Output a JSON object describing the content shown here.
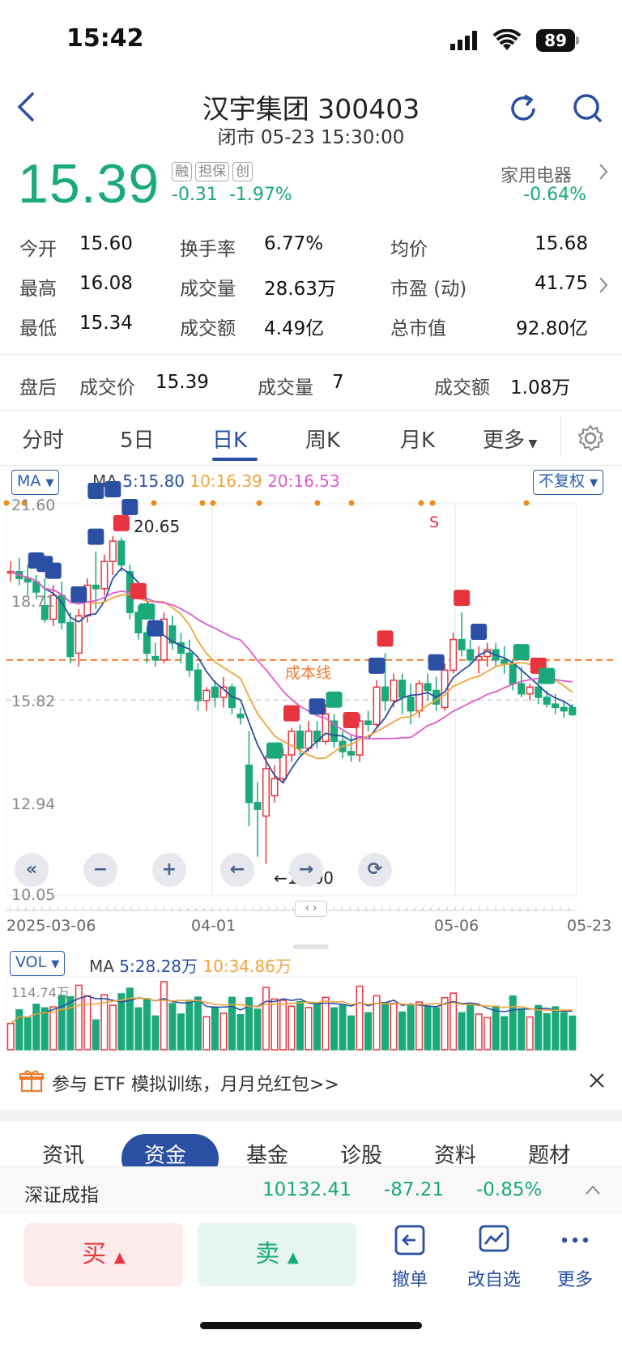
{
  "status": {
    "time": "15:42",
    "battery": "89"
  },
  "header": {
    "title": "汉宇集团 300403",
    "subtitle": "闭市 05-23 15:30:00",
    "price": "15.39",
    "tags": [
      "融",
      "担保",
      "创"
    ],
    "change_abs": "-0.31",
    "change_pct": "-1.97%",
    "industry": "家用电器",
    "industry_change": "-0.64%"
  },
  "stats": {
    "open_label": "今开",
    "open": "15.60",
    "turnover_label": "换手率",
    "turnover": "6.77%",
    "avg_label": "均价",
    "avg": "15.68",
    "high_label": "最高",
    "high": "16.08",
    "volume_label": "成交量",
    "volume": "28.63万",
    "pe_label": "市盈 (动)",
    "pe": "41.75",
    "low_label": "最低",
    "low": "15.34",
    "amount_label": "成交额",
    "amount": "4.49亿",
    "mcap_label": "总市值",
    "mcap": "92.80亿"
  },
  "after_hours": {
    "label": "盘后",
    "price_label": "成交价",
    "price": "15.39",
    "vol_label": "成交量",
    "vol": "7",
    "amt_label": "成交额",
    "amt": "1.08万"
  },
  "tabs": [
    "分时",
    "5日",
    "日K",
    "周K",
    "月K",
    "更多"
  ],
  "active_tab": "日K",
  "chart": {
    "ma_selector": "MA",
    "ma_title": "MA",
    "ma5": "5:15.80",
    "ma10": "10:16.39",
    "ma20": "20:16.53",
    "adjust": "不复权",
    "ylabels": [
      "21.60",
      "18.71",
      "15.82",
      "12.94",
      "10.05"
    ],
    "max_label": "20.65",
    "min_label": "←11.00",
    "cost_line": "成本线",
    "s_marker": "S",
    "dates": [
      "2025-03-06",
      "04-01",
      "05-06",
      "05-23"
    ],
    "vol_selector": "VOL",
    "vol_ma_title": "MA",
    "vol_ma5": "5:28.28万",
    "vol_ma10": "10:34.86万",
    "vol_max": "114.74万",
    "colors": {
      "up": "#e8343f",
      "down": "#1aa97a",
      "ma5": "#2a4fa3",
      "ma10": "#f2a33a",
      "ma20": "#e05ad0"
    }
  },
  "chart_data": {
    "type": "candlestick",
    "x_range": [
      "2025-03-06",
      "2025-05-23"
    ],
    "ylim": [
      10.05,
      21.6
    ],
    "series": [
      {
        "name": "MA",
        "values": []
      }
    ],
    "candles": [
      [
        19.6,
        19.9,
        19.3,
        19.6
      ],
      [
        19.6,
        20.0,
        19.2,
        19.4
      ],
      [
        19.4,
        19.8,
        18.9,
        19.3
      ],
      [
        19.3,
        19.5,
        18.8,
        19.0
      ],
      [
        18.6,
        19.4,
        18.1,
        18.2
      ],
      [
        18.2,
        19.2,
        18.0,
        18.9
      ],
      [
        18.9,
        19.3,
        17.9,
        18.1
      ],
      [
        18.1,
        18.4,
        16.9,
        17.1
      ],
      [
        17.2,
        18.5,
        16.8,
        18.3
      ],
      [
        18.3,
        19.4,
        18.1,
        19.2
      ],
      [
        19.2,
        20.2,
        18.5,
        19.1
      ],
      [
        19.1,
        20.1,
        18.9,
        19.9
      ],
      [
        19.9,
        20.65,
        19.5,
        20.5
      ],
      [
        20.5,
        20.6,
        19.6,
        19.8
      ],
      [
        19.6,
        19.8,
        18.2,
        18.4
      ],
      [
        18.4,
        18.6,
        17.6,
        17.8
      ],
      [
        17.8,
        18.0,
        16.9,
        17.2
      ],
      [
        17.1,
        17.5,
        16.8,
        17.0
      ],
      [
        17.0,
        18.4,
        16.9,
        18.2
      ],
      [
        18.0,
        18.3,
        17.3,
        17.5
      ],
      [
        17.5,
        17.8,
        16.9,
        17.2
      ],
      [
        17.2,
        17.6,
        16.5,
        16.7
      ],
      [
        16.7,
        16.9,
        15.5,
        15.8
      ],
      [
        15.8,
        16.2,
        15.5,
        16.1
      ],
      [
        16.2,
        16.4,
        15.6,
        15.9
      ],
      [
        15.9,
        16.5,
        15.6,
        16.2
      ],
      [
        16.2,
        16.3,
        15.4,
        15.6
      ],
      [
        15.4,
        15.6,
        15.1,
        15.3
      ],
      [
        13.9,
        14.9,
        12.1,
        12.8
      ],
      [
        12.8,
        13.4,
        11.2,
        12.6
      ],
      [
        12.4,
        14.2,
        11.0,
        13.8
      ],
      [
        13.0,
        13.9,
        12.8,
        13.5
      ],
      [
        13.5,
        14.4,
        13.4,
        14.2
      ],
      [
        14.2,
        15.0,
        14.0,
        14.9
      ],
      [
        14.9,
        15.1,
        14.2,
        14.4
      ],
      [
        14.4,
        15.2,
        14.3,
        14.9
      ],
      [
        14.9,
        15.2,
        14.4,
        14.6
      ],
      [
        14.6,
        15.7,
        14.5,
        15.4
      ],
      [
        15.2,
        15.4,
        14.4,
        14.6
      ],
      [
        14.6,
        14.9,
        14.1,
        14.3
      ],
      [
        14.3,
        14.8,
        14.0,
        14.2
      ],
      [
        14.2,
        15.4,
        14.0,
        15.2
      ],
      [
        15.2,
        15.5,
        14.9,
        15.1
      ],
      [
        15.1,
        16.4,
        15.0,
        16.2
      ],
      [
        16.2,
        17.2,
        15.5,
        15.8
      ],
      [
        15.8,
        16.6,
        15.6,
        16.4
      ],
      [
        16.4,
        16.6,
        15.4,
        15.9
      ],
      [
        15.9,
        16.3,
        15.1,
        15.5
      ],
      [
        15.5,
        16.4,
        15.3,
        16.3
      ],
      [
        16.3,
        16.6,
        15.8,
        16.1
      ],
      [
        16.1,
        16.5,
        15.5,
        15.7
      ],
      [
        15.6,
        16.9,
        15.5,
        16.7
      ],
      [
        16.7,
        17.8,
        16.6,
        17.6
      ],
      [
        17.6,
        18.4,
        17.1,
        17.3
      ],
      [
        17.3,
        17.6,
        16.9,
        17.0
      ],
      [
        17.0,
        17.4,
        16.6,
        17.1
      ],
      [
        17.1,
        17.5,
        16.8,
        17.3
      ],
      [
        17.3,
        17.5,
        16.8,
        17.0
      ],
      [
        17.0,
        17.4,
        16.6,
        16.9
      ],
      [
        16.9,
        17.0,
        16.1,
        16.3
      ],
      [
        16.3,
        16.8,
        15.9,
        16.0
      ],
      [
        16.0,
        16.3,
        15.8,
        16.2
      ],
      [
        16.2,
        16.4,
        15.7,
        15.9
      ],
      [
        15.9,
        16.1,
        15.6,
        15.7
      ],
      [
        15.7,
        16.0,
        15.4,
        15.6
      ],
      [
        15.6,
        15.8,
        15.3,
        15.5
      ],
      [
        15.6,
        15.7,
        15.34,
        15.39
      ]
    ],
    "ylabel": "",
    "xlabel": ""
  },
  "banner": {
    "text": "参与 ETF 模拟训练，月月兑红包>>"
  },
  "info_tabs": [
    "资讯",
    "资金",
    "基金",
    "诊股",
    "资料",
    "题材"
  ],
  "index": {
    "name": "深证成指",
    "value": "10132.41",
    "change": "-87.21",
    "pct": "-0.85%"
  },
  "bottom": {
    "buy": "买",
    "sell": "卖",
    "cancel": "撤单",
    "watch": "改自选",
    "more": "更多"
  }
}
